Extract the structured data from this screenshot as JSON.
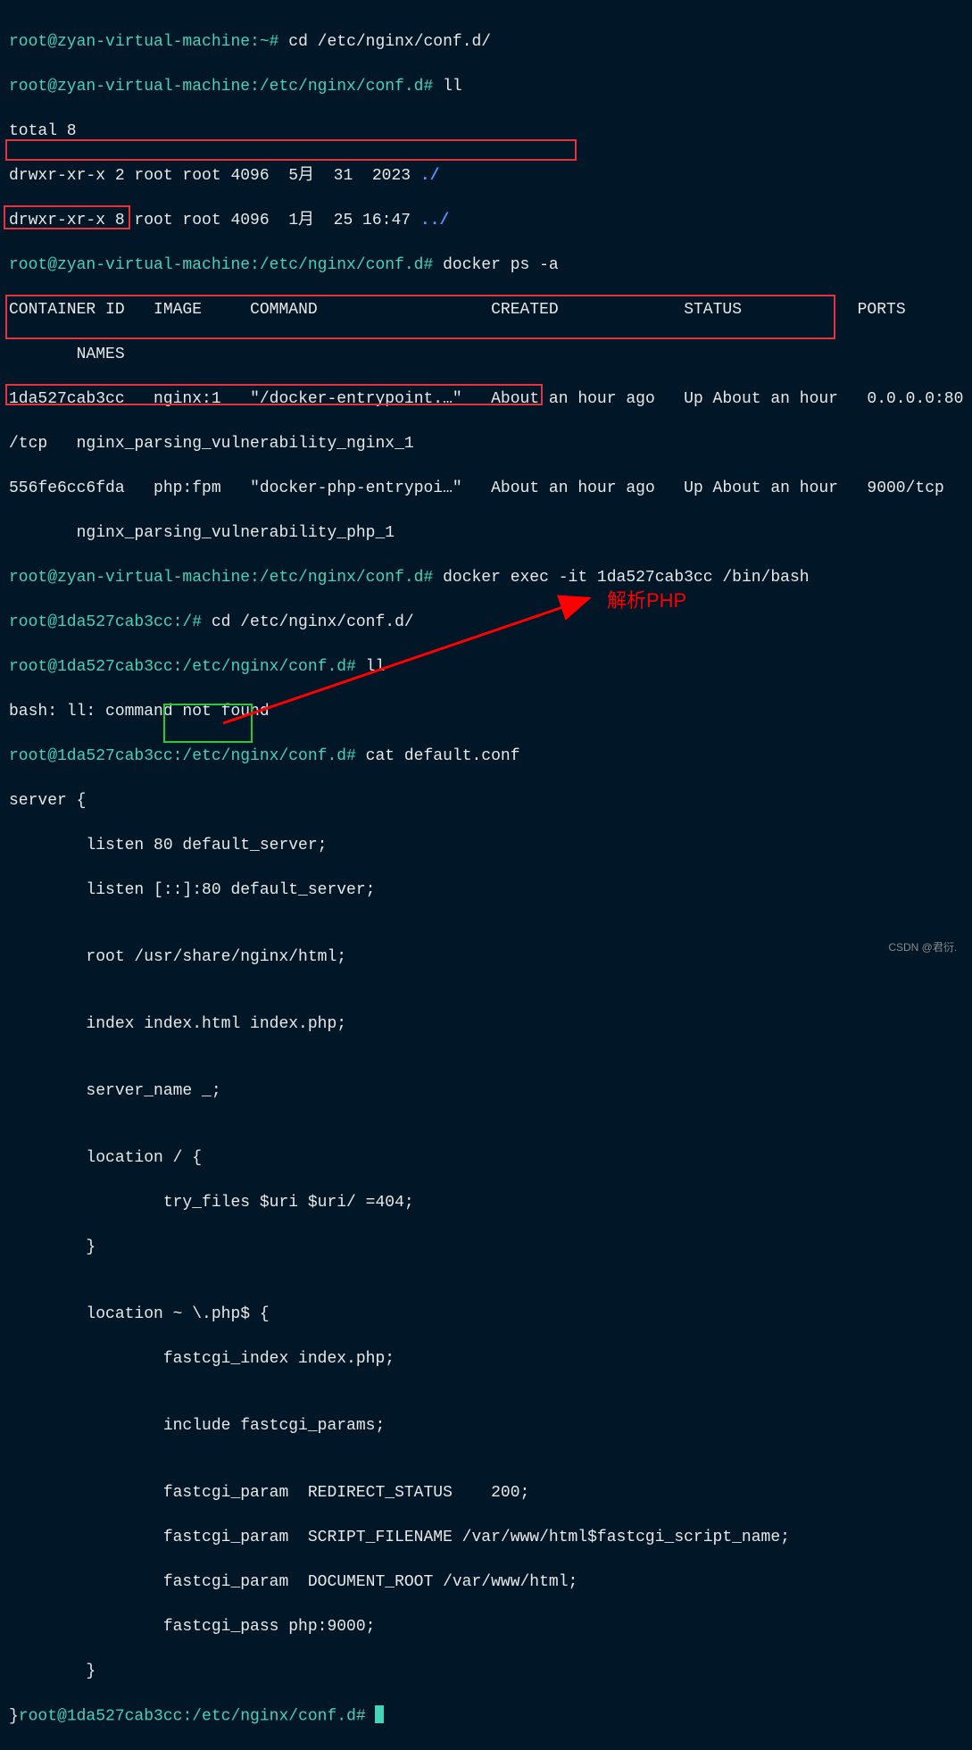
{
  "lines": {
    "l1_prompt": "root@zyan-virtual-machine:~# ",
    "l1_cmd": "cd /etc/nginx/conf.d/",
    "l2_prompt": "root@zyan-virtual-machine:/etc/nginx/conf.d# ",
    "l2_cmd": "ll",
    "l3": "total 8",
    "l4_perm": "drwxr-xr-x 2 root root 4096  5月  31  2023 ",
    "l4_dot": "./",
    "l5_perm": "drwxr-xr-x 8 root root 4096  1月  25 16:47 ",
    "l5_dot": "../",
    "l6_prompt": "root@zyan-virtual-machine:/etc/nginx/conf.d# ",
    "l6_cmd": "docker ps -a",
    "l7_h1": "CONTAINER ID",
    "l7_h2": "IMAGE",
    "l7_h3": "COMMAND",
    "l7_h4": "CREATED",
    "l7_h5": "STATUS",
    "l7_h6": "PORTS",
    "l7_h7": "NAMES",
    "r1_id": "1da527cab3cc",
    "r1_img": "nginx:1",
    "r1_cmd": "\"/docker-entrypoint.…\"",
    "r1_created": "About an hour ago",
    "r1_status": "Up About an hour",
    "r1_ports": "0.0.0.0:80",
    "r1_ports2": "/tcp",
    "r1_name": "nginx_parsing_vulnerability_nginx_1",
    "r2_id": "556fe6cc6fda",
    "r2_img": "php:fpm",
    "r2_cmd": "\"docker-php-entrypoi…\"",
    "r2_created": "About an hour ago",
    "r2_status": "Up About an hour",
    "r2_ports": "9000/tcp",
    "r2_name": "nginx_parsing_vulnerability_php_1",
    "l11_prompt": "root@zyan-virtual-machine:/etc/nginx/conf.d# ",
    "l11_cmd": "docker exec -it 1da527cab3cc /bin/bash",
    "l12_prompt": "root@1da527cab3cc:/# ",
    "l12_cmd": "cd /etc/nginx/conf.d/",
    "l13_prompt": "root@1da527cab3cc:/etc/nginx/conf.d# ",
    "l13_cmd": "ll",
    "l14": "bash: ll: command not found",
    "l15_prompt": "root@1da527cab3cc:/etc/nginx/conf.d# ",
    "l15_cmd": "cat default.conf",
    "cfg1": "server {",
    "cfg2": "        listen 80 default_server;",
    "cfg3": "        listen [::]:80 default_server;",
    "cfg4": "",
    "cfg5": "        root /usr/share/nginx/html;",
    "cfg6": "",
    "cfg7": "        index index.html index.php;",
    "cfg8": "",
    "cfg9": "        server_name _;",
    "cfg10": "",
    "cfg11": "        location / {",
    "cfg12": "                try_files $uri $uri/ =404;",
    "cfg13": "        }",
    "cfg14": "",
    "cfg15": "        location ~ \\.php$ {",
    "cfg16": "                fastcgi_index index.php;",
    "cfg17": "",
    "cfg18": "                include fastcgi_params;",
    "cfg19": "",
    "cfg20": "                fastcgi_param  REDIRECT_STATUS    200;",
    "cfg21": "                fastcgi_param  SCRIPT_FILENAME /var/www/html$fastcgi_script_name;",
    "cfg22": "                fastcgi_param  DOCUMENT_ROOT /var/www/html;",
    "cfg23": "                fastcgi_pass php:9000;",
    "cfg24": "        }",
    "cfg25_a": "}",
    "last_prompt": "root@1da527cab3cc:/etc/nginx/conf.d# "
  },
  "annotation": "解析PHP",
  "watermark": "CSDN @君衍.⠀"
}
